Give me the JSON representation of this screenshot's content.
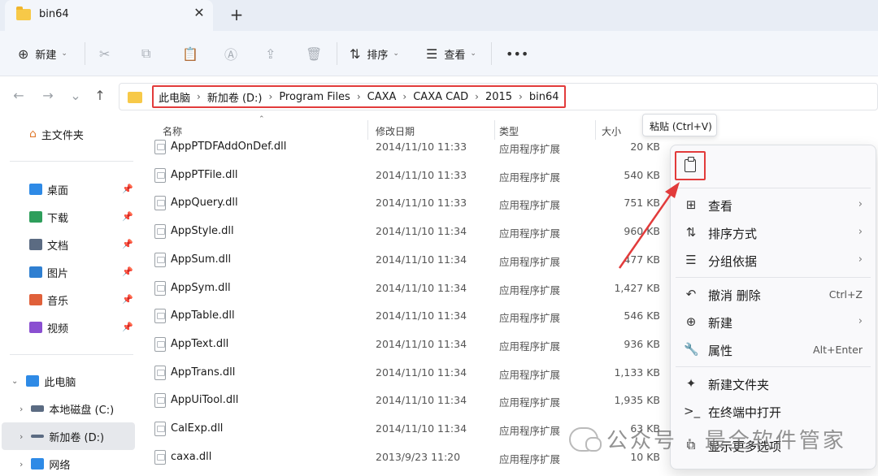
{
  "tab": {
    "title": "bin64",
    "close_glyph": "✕",
    "new_glyph": "+"
  },
  "toolbar": {
    "new_label": "新建",
    "sort_label": "排序",
    "view_label": "查看",
    "more_glyph": "•••",
    "icons": [
      "cut-icon",
      "copy-icon",
      "paste-icon",
      "rename-icon",
      "share-icon",
      "delete-icon"
    ]
  },
  "nav": {
    "back": "←",
    "forward": "→",
    "recent": "⌄",
    "up": "↑"
  },
  "breadcrumb": [
    "此电脑",
    "新加卷 (D:)",
    "Program Files",
    "CAXA",
    "CAXA CAD",
    "2015",
    "bin64"
  ],
  "sidebar": {
    "home": "主文件夹",
    "quick": [
      {
        "label": "桌面",
        "color": "#2e8ae6"
      },
      {
        "label": "下载",
        "color": "#2e9e5b"
      },
      {
        "label": "文档",
        "color": "#5b6b82"
      },
      {
        "label": "图片",
        "color": "#2f7fd1"
      },
      {
        "label": "音乐",
        "color": "#e0603a"
      },
      {
        "label": "视频",
        "color": "#8a4fd1"
      }
    ],
    "this_pc": "此电脑",
    "drives": [
      "本地磁盘 (C:)",
      "新加卷 (D:)"
    ],
    "network": "网络"
  },
  "columns": {
    "name": "名称",
    "date": "修改日期",
    "type": "类型",
    "size": "大小"
  },
  "files": [
    {
      "name": "AppPTDFAddOnDef.dll",
      "date": "2014/11/10 11:33",
      "type": "应用程序扩展",
      "size": "20 KB"
    },
    {
      "name": "AppPTFile.dll",
      "date": "2014/11/10 11:33",
      "type": "应用程序扩展",
      "size": "540 KB"
    },
    {
      "name": "AppQuery.dll",
      "date": "2014/11/10 11:33",
      "type": "应用程序扩展",
      "size": "751 KB"
    },
    {
      "name": "AppStyle.dll",
      "date": "2014/11/10 11:34",
      "type": "应用程序扩展",
      "size": "960 KB"
    },
    {
      "name": "AppSum.dll",
      "date": "2014/11/10 11:34",
      "type": "应用程序扩展",
      "size": "477 KB"
    },
    {
      "name": "AppSym.dll",
      "date": "2014/11/10 11:34",
      "type": "应用程序扩展",
      "size": "1,427 KB"
    },
    {
      "name": "AppTable.dll",
      "date": "2014/11/10 11:34",
      "type": "应用程序扩展",
      "size": "546 KB"
    },
    {
      "name": "AppText.dll",
      "date": "2014/11/10 11:34",
      "type": "应用程序扩展",
      "size": "936 KB"
    },
    {
      "name": "AppTrans.dll",
      "date": "2014/11/10 11:34",
      "type": "应用程序扩展",
      "size": "1,133 KB"
    },
    {
      "name": "AppUiTool.dll",
      "date": "2014/11/10 11:34",
      "type": "应用程序扩展",
      "size": "1,935 KB"
    },
    {
      "name": "CalExp.dll",
      "date": "2014/11/10 11:34",
      "type": "应用程序扩展",
      "size": "63 KB"
    },
    {
      "name": "caxa.dll",
      "date": "2013/9/23 11:20",
      "type": "应用程序扩展",
      "size": "10 KB"
    }
  ],
  "tooltip": "粘贴 (Ctrl+V)",
  "context_menu": {
    "items": [
      {
        "icon": "⊞",
        "icon_name": "view-icon",
        "label": "查看",
        "arrow": "›",
        "shortcut": ""
      },
      {
        "icon": "⇅",
        "icon_name": "sort-icon",
        "label": "排序方式",
        "arrow": "›",
        "shortcut": ""
      },
      {
        "icon": "☰",
        "icon_name": "group-icon",
        "label": "分组依据",
        "arrow": "›",
        "shortcut": ""
      },
      {
        "icon": "↶",
        "icon_name": "undo-icon",
        "label": "撤消 删除",
        "arrow": "",
        "shortcut": "Ctrl+Z"
      },
      {
        "icon": "⊕",
        "icon_name": "new-icon",
        "label": "新建",
        "arrow": "›",
        "shortcut": ""
      },
      {
        "icon": "🔧",
        "icon_name": "properties-icon",
        "label": "属性",
        "arrow": "",
        "shortcut": "Alt+Enter"
      },
      {
        "icon": "✦",
        "icon_name": "new-folder-icon",
        "label": "新建文件夹",
        "arrow": "",
        "shortcut": ""
      },
      {
        "icon": ">_",
        "icon_name": "terminal-icon",
        "label": "在终端中打开",
        "arrow": "",
        "shortcut": ""
      },
      {
        "icon": "⧉",
        "icon_name": "more-options-icon",
        "label": "显示更多选项",
        "arrow": "",
        "shortcut": ""
      }
    ]
  },
  "watermark": {
    "text": "公众号 · 最全软件管家"
  },
  "colors": {
    "highlight": "#e23b3b",
    "tab_bg": "#f3f6fb",
    "accent": "#0067c0"
  }
}
